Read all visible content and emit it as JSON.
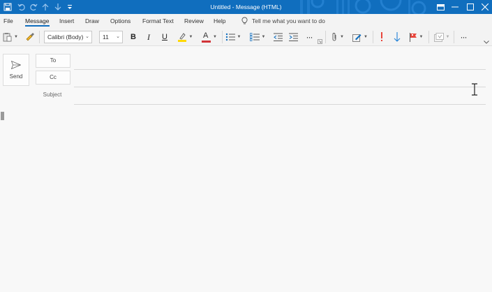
{
  "window": {
    "title": "Untitled  -  Message (HTML)"
  },
  "menu": {
    "tabs": [
      {
        "label": "File"
      },
      {
        "label": "Message"
      },
      {
        "label": "Insert"
      },
      {
        "label": "Draw"
      },
      {
        "label": "Options"
      },
      {
        "label": "Format Text"
      },
      {
        "label": "Review"
      },
      {
        "label": "Help"
      }
    ],
    "active_tab": "Message",
    "tell_me": "Tell me what you want to do"
  },
  "ribbon": {
    "font_name": "Calibri (Body)",
    "font_size": "11",
    "bold": "B",
    "italic": "I",
    "underline": "U",
    "font_color_glyph": "A",
    "more": "···",
    "highlight_color": "#ffd800",
    "font_color": "#d13438",
    "accent_color": "#106ebe",
    "importance_high_color": "#e8463c",
    "importance_low_color": "#1e7fd6"
  },
  "compose": {
    "send_label": "Send",
    "to_label": "To",
    "cc_label": "Cc",
    "subject_label": "Subject",
    "to_value": "",
    "cc_value": "",
    "subject_value": "",
    "body_value": ""
  }
}
